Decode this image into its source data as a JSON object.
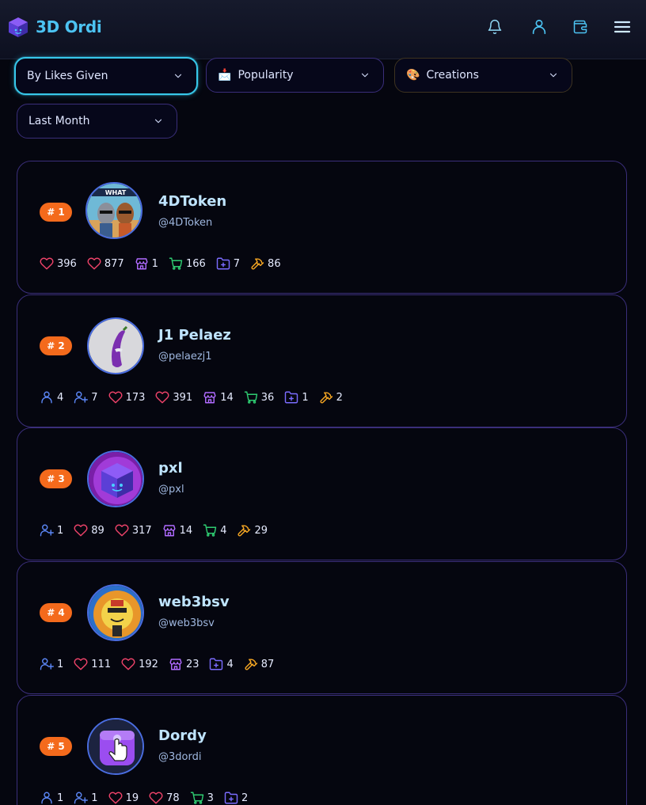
{
  "app": {
    "title": "3D Ordi"
  },
  "header": {
    "icons": [
      "bell-icon",
      "user-icon",
      "wallet-icon",
      "menu-icon"
    ]
  },
  "filters": {
    "sort_by": "By Likes Given",
    "category": {
      "label": "Popularity",
      "emoji": "📩"
    },
    "type": {
      "label": "Creations",
      "emoji": "🎨"
    },
    "period": "Last Month"
  },
  "colors": {
    "accent": "#37c8ea",
    "rank_badge": "#f46a1c",
    "card_border": "#3a2e7a",
    "heart": "#f0436a",
    "store": "#b06bff",
    "cart": "#2ecc71",
    "folder": "#7b6cff",
    "hammer": "#f5a623",
    "user": "#5b86f5"
  },
  "leaderboard": [
    {
      "rank": "# 1",
      "name": "4DToken",
      "handle": "@4DToken",
      "stats": [
        {
          "icon": "heart-icon",
          "value": "396"
        },
        {
          "icon": "heart-icon",
          "value": "877"
        },
        {
          "icon": "store-icon",
          "value": "1"
        },
        {
          "icon": "cart-icon",
          "value": "166"
        },
        {
          "icon": "folder-plus-icon",
          "value": "7"
        },
        {
          "icon": "hammer-icon",
          "value": "86"
        }
      ]
    },
    {
      "rank": "# 2",
      "name": "J1 Pelaez",
      "handle": "@pelaezj1",
      "stats": [
        {
          "icon": "user-icon",
          "value": "4"
        },
        {
          "icon": "user-plus-icon",
          "value": "7"
        },
        {
          "icon": "heart-icon",
          "value": "173"
        },
        {
          "icon": "heart-icon",
          "value": "391"
        },
        {
          "icon": "store-icon",
          "value": "14"
        },
        {
          "icon": "cart-icon",
          "value": "36"
        },
        {
          "icon": "folder-plus-icon",
          "value": "1"
        },
        {
          "icon": "hammer-icon",
          "value": "2"
        }
      ]
    },
    {
      "rank": "# 3",
      "name": "pxl",
      "handle": "@pxl",
      "stats": [
        {
          "icon": "user-plus-icon",
          "value": "1"
        },
        {
          "icon": "heart-icon",
          "value": "89"
        },
        {
          "icon": "heart-icon",
          "value": "317"
        },
        {
          "icon": "store-icon",
          "value": "14"
        },
        {
          "icon": "cart-icon",
          "value": "4"
        },
        {
          "icon": "hammer-icon",
          "value": "29"
        }
      ]
    },
    {
      "rank": "# 4",
      "name": "web3bsv",
      "handle": "@web3bsv",
      "stats": [
        {
          "icon": "user-plus-icon",
          "value": "1"
        },
        {
          "icon": "heart-icon",
          "value": "111"
        },
        {
          "icon": "heart-icon",
          "value": "192"
        },
        {
          "icon": "store-icon",
          "value": "23"
        },
        {
          "icon": "folder-plus-icon",
          "value": "4"
        },
        {
          "icon": "hammer-icon",
          "value": "87"
        }
      ]
    },
    {
      "rank": "# 5",
      "name": "Dordy",
      "handle": "@3dordi",
      "stats": [
        {
          "icon": "user-icon",
          "value": "1"
        },
        {
          "icon": "user-plus-icon",
          "value": "1"
        },
        {
          "icon": "heart-icon",
          "value": "19"
        },
        {
          "icon": "heart-icon",
          "value": "78"
        },
        {
          "icon": "cart-icon",
          "value": "3"
        },
        {
          "icon": "folder-plus-icon",
          "value": "2"
        }
      ]
    }
  ]
}
